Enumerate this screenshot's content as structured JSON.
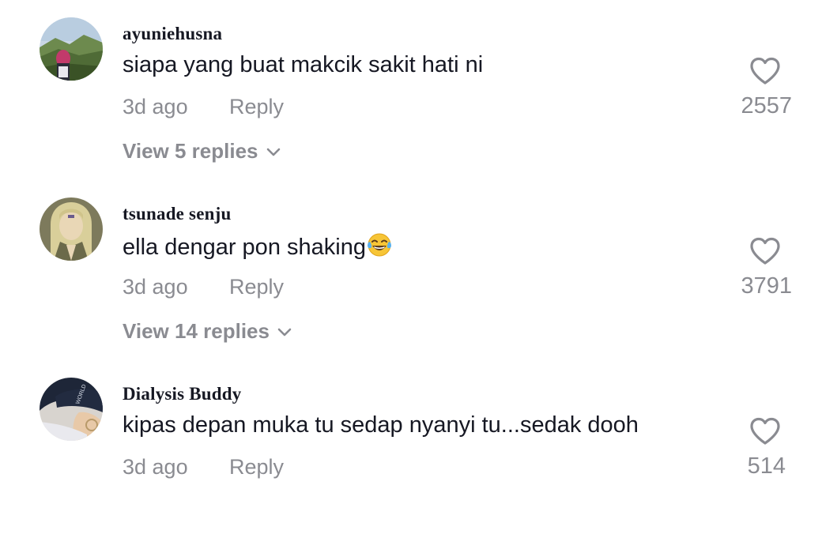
{
  "comments": [
    {
      "username": "ayuniehusna",
      "text": "siapa yang buat makcik sakit hati ni",
      "time": "3d ago",
      "reply_label": "Reply",
      "likes": "2557",
      "view_replies": "View 5 replies",
      "avatar_icon": "profile-photo-mountains"
    },
    {
      "username": "tsunade senju",
      "text": "ella dengar pon shaking",
      "emoji": "face-with-tears-of-joy",
      "time": "3d ago",
      "reply_label": "Reply",
      "likes": "3791",
      "view_replies": "View 14 replies",
      "avatar_icon": "profile-photo-anime"
    },
    {
      "username": "Dialysis Buddy",
      "text": "kipas depan muka tu sedap nyanyi tu...sedak dooh",
      "time": "3d ago",
      "reply_label": "Reply",
      "likes": "514",
      "avatar_icon": "profile-photo-cap"
    }
  ],
  "colors": {
    "primary_text": "#161823",
    "secondary_text": "#8a8b91",
    "heart_stroke": "#8a8b91"
  }
}
